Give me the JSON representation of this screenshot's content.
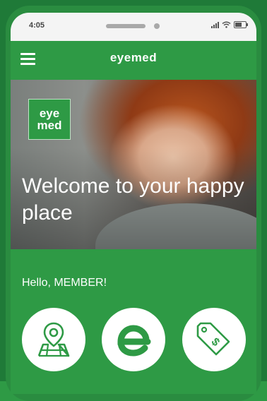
{
  "status_bar": {
    "time": "4:05"
  },
  "header": {
    "logo_text": "eyemed"
  },
  "hero": {
    "badge_line1": "eye",
    "badge_line2": "med",
    "title": "Welcome to your happy place"
  },
  "greeting": "Hello, MEMBER!",
  "quick_actions": [
    {
      "icon": "map-pin-icon"
    },
    {
      "icon": "eyemed-e-icon"
    },
    {
      "icon": "price-tag-icon"
    }
  ],
  "colors": {
    "brand_green": "#2e9a45",
    "frame_green": "#1f7a38"
  }
}
